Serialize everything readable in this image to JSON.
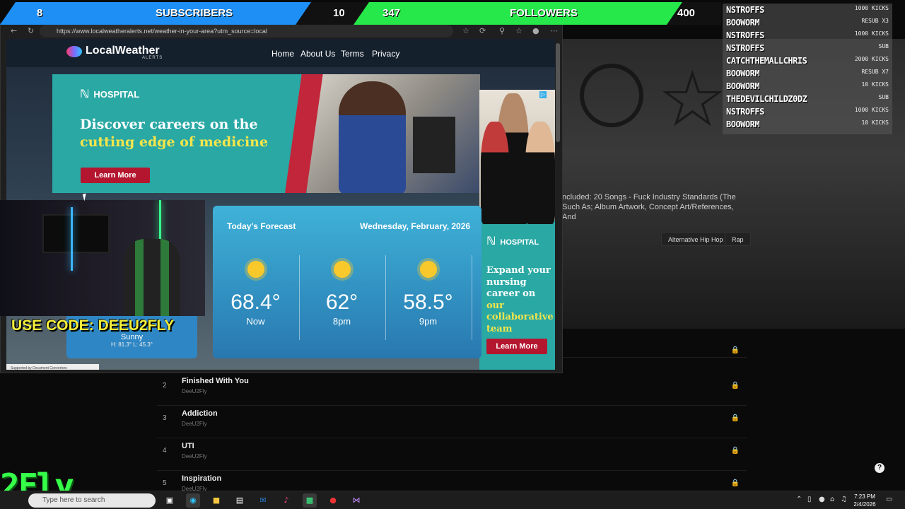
{
  "banner": {
    "sub_count": "8",
    "sub_label": "SUBSCRIBERS",
    "sub_goal": "10",
    "fol_count": "347",
    "fol_label": "FOLLOWERS",
    "fol_goal": "400",
    "colors": {
      "sub": "#1e8ff5",
      "fol": "#26e84a"
    }
  },
  "browser": {
    "url": "https://www.localweatheralerts.net/weather-in-your-area?utm_source=local"
  },
  "site": {
    "logo": "LocalWeather",
    "logo_sub": "ALERTS",
    "nav": [
      "Home",
      "About Us",
      "Terms",
      "Privacy"
    ],
    "ad1": {
      "brand": "HOSPITAL",
      "line1": "Discover careers on the",
      "line2": "cutting edge of medicine",
      "cta": "Learn More"
    },
    "ad2": {
      "brand": "HOSPITAL",
      "t1": "Expand your nursing career on ",
      "t2": "our collaborative team",
      "cta": "Learn More"
    },
    "forecast": {
      "title": "Today's Forecast",
      "date": "Wednesday, February, 2026",
      "items": [
        {
          "temp": "68.4°",
          "label": "Now"
        },
        {
          "temp": "62°",
          "label": "8pm"
        },
        {
          "temp": "58.5°",
          "label": "9pm"
        }
      ]
    },
    "current": {
      "cond": "Sunny",
      "hilo": "H: 81.3°  L: 45.3°"
    },
    "supported": "Supported by   Document Converters"
  },
  "overlay": {
    "code": "USE CODE: DEEU2FLY",
    "brand": "2Fly"
  },
  "music": {
    "desc": "ncluded: 20 Songs - Fuck Industry Standards (The Such As; Album Artwork, Concept Art/References, And",
    "tags": [
      "Alternative Hip Hop",
      "Rap"
    ],
    "tracks": [
      {
        "num": "2",
        "title": "Finished With You",
        "artist": "DeeU2Fly"
      },
      {
        "num": "3",
        "title": "Addiction",
        "artist": "DeeU2Fly"
      },
      {
        "num": "4",
        "title": "UTI",
        "artist": "DeeU2Fly"
      },
      {
        "num": "5",
        "title": "Inspiration",
        "artist": "DeeU2Fly"
      }
    ]
  },
  "feed": [
    {
      "user": "NSTROFFS",
      "amt": "1000 KICKS"
    },
    {
      "user": "BOOWORM",
      "amt": "RESUB X3"
    },
    {
      "user": "NSTROFFS",
      "amt": "1000 KICKS"
    },
    {
      "user": "NSTROFFS",
      "amt": "SUB"
    },
    {
      "user": "CATCHTHEMALLCHRIS",
      "amt": "2000 KICKS"
    },
    {
      "user": "BOOWORM",
      "amt": "RESUB X7"
    },
    {
      "user": "BOOWORM",
      "amt": "10 KICKS"
    },
    {
      "user": "THEDEVILCHILDZ0DZ",
      "amt": "SUB"
    },
    {
      "user": "NSTROFFS",
      "amt": "1000 KICKS"
    },
    {
      "user": "BOOWORM",
      "amt": "10 KICKS"
    }
  ],
  "taskbar": {
    "search": "Type here to search",
    "time": "7:23 PM",
    "date": "2/4/2026"
  }
}
